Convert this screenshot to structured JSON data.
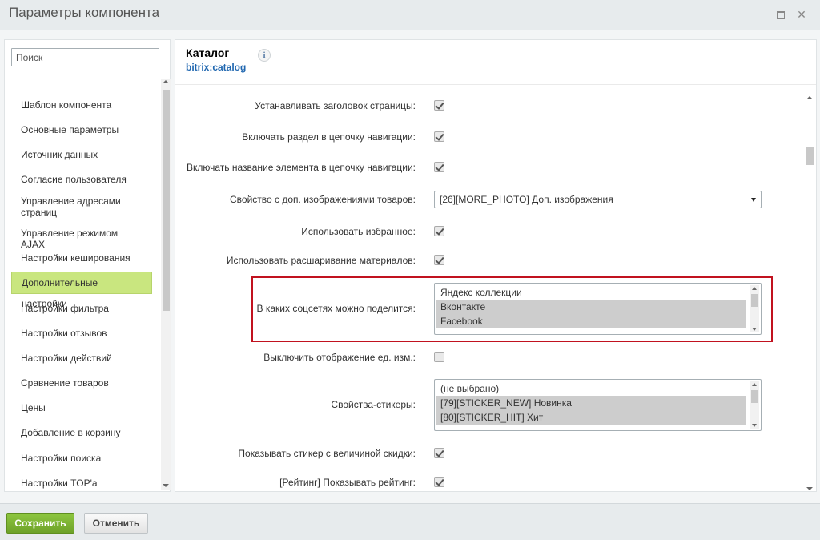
{
  "window": {
    "title": "Параметры компонента"
  },
  "sidebar": {
    "search_placeholder": "Поиск",
    "items": [
      {
        "label": "Шаблон компонента"
      },
      {
        "label": "Основные параметры"
      },
      {
        "label": "Источник данных"
      },
      {
        "label": "Согласие пользователя"
      },
      {
        "label": "Управление адресами страниц"
      },
      {
        "label": "Управление режимом AJAX"
      },
      {
        "label": "Настройки кеширования"
      },
      {
        "label": "Дополнительные настройки",
        "active": true
      },
      {
        "label": "Настройки фильтра"
      },
      {
        "label": "Настройки отзывов"
      },
      {
        "label": "Настройки действий"
      },
      {
        "label": "Сравнение товаров"
      },
      {
        "label": "Цены"
      },
      {
        "label": "Добавление в корзину"
      },
      {
        "label": "Настройки поиска"
      },
      {
        "label": "Настройки TOP'а"
      }
    ]
  },
  "component": {
    "title": "Каталог",
    "code": "bitrix:catalog",
    "info_icon": "i"
  },
  "settings": [
    {
      "label": "Устанавливать заголовок страницы:",
      "type": "checkbox",
      "checked": true
    },
    {
      "label": "Включать раздел в цепочку навигации:",
      "type": "checkbox",
      "checked": true
    },
    {
      "label": "Включать название элемента в цепочку навигации:",
      "type": "checkbox",
      "checked": true
    },
    {
      "label": "Свойство с доп. изображениями товаров:",
      "type": "select",
      "value": "[26][MORE_PHOTO] Доп. изображения"
    },
    {
      "label": "Использовать избранное:",
      "type": "checkbox",
      "checked": true
    },
    {
      "label": "Использовать расшаривание материалов:",
      "type": "checkbox",
      "checked": true
    },
    {
      "label": "В каких соцсетях можно поделится:",
      "type": "multiselect",
      "options": [
        {
          "text": "Яндекс коллекции",
          "selected": false
        },
        {
          "text": "Вконтакте",
          "selected": true
        },
        {
          "text": "Facebook",
          "selected": true
        }
      ]
    },
    {
      "label": "Выключить отображение ед. изм.:",
      "type": "checkbox",
      "checked": false
    },
    {
      "label": "Свойства-стикеры:",
      "type": "multiselect",
      "options": [
        {
          "text": "(не выбрано)",
          "selected": false
        },
        {
          "text": "[79][STICKER_NEW] Новинка",
          "selected": true
        },
        {
          "text": "[80][STICKER_HIT] Хит",
          "selected": true
        }
      ]
    },
    {
      "label": "Показывать стикер с величиной скидки:",
      "type": "checkbox",
      "checked": true
    },
    {
      "label": "[Рейтинг] Показывать рейтинг:",
      "type": "checkbox",
      "checked": true
    }
  ],
  "footer": {
    "save_label": "Сохранить",
    "cancel_label": "Отменить"
  },
  "colors": {
    "accent_green": "#8dc63f",
    "active_nav": "#c9e67f",
    "highlight_red": "#c1121f",
    "link_blue": "#2067b0"
  }
}
